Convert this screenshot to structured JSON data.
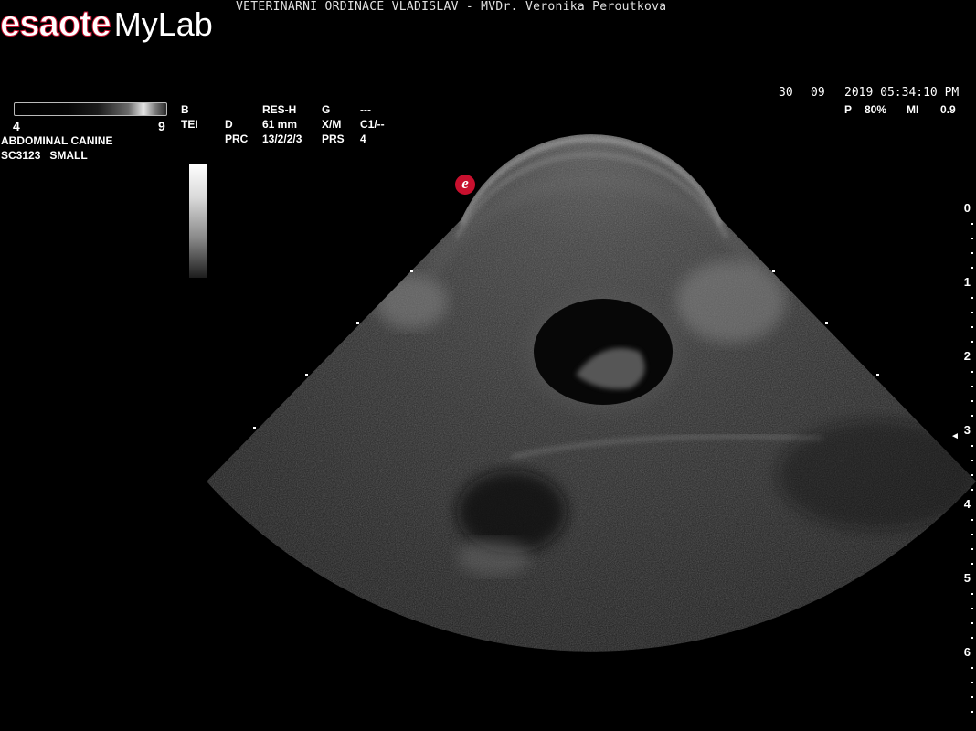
{
  "brand": {
    "part1": "esaote",
    "part2": "MyLab",
    "accent": "#c8102e"
  },
  "header": {
    "clinic": "VETERINARNI ORDINACE VLADISLAV - MVDr. Veronika Peroutkova"
  },
  "datetime": {
    "day": "30",
    "month": "09",
    "time": "2019 05:34:10 PM"
  },
  "power": {
    "p_label": "P",
    "p_value": "80%",
    "mi_label": "MI",
    "mi_value": "0.9"
  },
  "dynamic_range": {
    "min": "4",
    "max": "9"
  },
  "preset": {
    "line1": "ABDOMINAL CANINE",
    "line2": "SC3123   SMALL"
  },
  "params": {
    "mode": "B",
    "tei": "TEI",
    "res_label": "RES-H",
    "d_label": "D",
    "depth": "61 mm",
    "prc_label": "PRC",
    "prc_value": "13/2/2/3",
    "g_label": "G",
    "g_value": "---",
    "xm_label": "X/M",
    "xm_value": "C1/--",
    "prs_label": "PRS",
    "prs_value": "4"
  },
  "depth_scale": [
    "0",
    "1",
    "2",
    "3",
    "4",
    "5",
    "6"
  ],
  "focus_marker": "◄"
}
